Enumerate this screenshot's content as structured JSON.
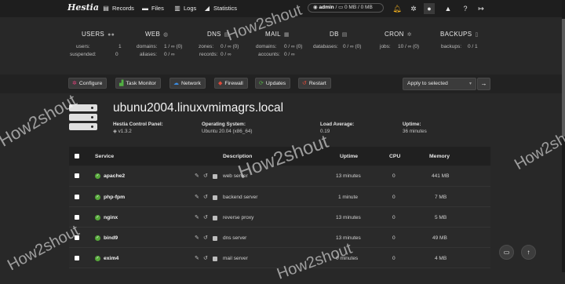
{
  "nav": {
    "logo": "Hestia",
    "links": [
      {
        "label": "Records",
        "icon": "records-icon",
        "glyph": "▤"
      },
      {
        "label": "Files",
        "icon": "folder-icon",
        "glyph": "▬"
      },
      {
        "label": "Logs",
        "icon": "logs-icon",
        "glyph": "▥"
      },
      {
        "label": "Statistics",
        "icon": "chart-icon",
        "glyph": "◢"
      }
    ],
    "user": {
      "name": "admin",
      "sep1": " / ",
      "disk": "0 MB",
      "sep2": " / ",
      "quota": "0 MB"
    }
  },
  "stats": [
    {
      "title": "USERS",
      "icon": "users-icon",
      "glyph": "●●",
      "rows": [
        {
          "label": "users:",
          "value": "1"
        },
        {
          "label": "suspended:",
          "value": "0"
        }
      ]
    },
    {
      "title": "WEB",
      "icon": "globe-icon",
      "glyph": "◍",
      "rows": [
        {
          "label": "domains:",
          "value": "1 / ∞ (0)"
        },
        {
          "label": "aliases:",
          "value": "0 / ∞"
        }
      ]
    },
    {
      "title": "DNS",
      "icon": "database-icon",
      "glyph": "▤",
      "rows": [
        {
          "label": "zones:",
          "value": "0 / ∞ (0)"
        },
        {
          "label": "records:",
          "value": "0 / ∞"
        }
      ]
    },
    {
      "title": "MAIL",
      "icon": "mail-icon",
      "glyph": "▦",
      "rows": [
        {
          "label": "domains:",
          "value": "0 / ∞ (0)"
        },
        {
          "label": "accounts:",
          "value": "0 / ∞"
        }
      ]
    },
    {
      "title": "DB",
      "icon": "db-icon",
      "glyph": "▤",
      "rows": [
        {
          "label": "databases:",
          "value": "0 / ∞ (0)"
        }
      ]
    },
    {
      "title": "CRON",
      "icon": "gear-icon",
      "glyph": "✲",
      "rows": [
        {
          "label": "jobs:",
          "value": "10 / ∞ (0)"
        }
      ]
    },
    {
      "title": "BACKUPS",
      "icon": "file-icon",
      "glyph": "▯",
      "rows": [
        {
          "label": "backups:",
          "value": "0 / 1"
        }
      ]
    }
  ],
  "toolbar": {
    "buttons": [
      {
        "label": "Configure",
        "icon": "gear-icon",
        "glyph": "✲",
        "color": "#e0407a"
      },
      {
        "label": "Task Monitor",
        "icon": "chart-icon",
        "glyph": "▟",
        "color": "#52b043"
      },
      {
        "label": "Network",
        "icon": "cloud-icon",
        "glyph": "☁",
        "color": "#3b8ee6"
      },
      {
        "label": "Firewall",
        "icon": "shield-icon",
        "glyph": "◆",
        "color": "#e04a3a"
      },
      {
        "label": "Updates",
        "icon": "refresh-icon",
        "glyph": "⟳",
        "color": "#52b043"
      },
      {
        "label": "Restart",
        "icon": "undo-icon",
        "glyph": "↺",
        "color": "#e04a3a"
      }
    ],
    "apply_select": "Apply to selected"
  },
  "server": {
    "hostname": "ubunu2004.linuxvmimagrs.local",
    "panel_label": "Hestia Control Panel:",
    "panel_value": "v1.3.2",
    "os_label": "Operating System:",
    "os_value": "Ubuntu 20.04 (x86_64)",
    "load_label": "Load Average:",
    "load_value": "0.19",
    "uptime_label": "Uptime:",
    "uptime_value": "36 minutes"
  },
  "table": {
    "headers": {
      "service": "Service",
      "description": "Description",
      "uptime": "Uptime",
      "cpu": "CPU",
      "memory": "Memory"
    },
    "rows": [
      {
        "name": "apache2",
        "description": "web server",
        "uptime": "13 minutes",
        "cpu": "0",
        "memory": "441 MB"
      },
      {
        "name": "php-fpm",
        "description": "backend server",
        "uptime": "1 minute",
        "cpu": "0",
        "memory": "7 MB"
      },
      {
        "name": "nginx",
        "description": "reverse proxy",
        "uptime": "13 minutes",
        "cpu": "0",
        "memory": "5 MB"
      },
      {
        "name": "bind9",
        "description": "dns server",
        "uptime": "13 minutes",
        "cpu": "0",
        "memory": "49 MB"
      },
      {
        "name": "exim4",
        "description": "mail server",
        "uptime": "0 minutes",
        "cpu": "0",
        "memory": "4 MB"
      }
    ]
  },
  "watermark": "How2shout",
  "colors": {
    "accent_ok": "#56a83a",
    "bell": "#f2b01e",
    "bg": "#282828"
  }
}
